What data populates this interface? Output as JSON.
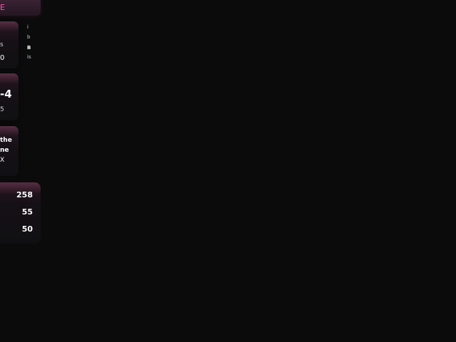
{
  "header": {
    "title": "E"
  },
  "cards": [
    {
      "label": "s",
      "value": "0"
    },
    {
      "value": "-4",
      "sub": "5"
    },
    {
      "lines": [
        "the",
        "ne",
        "X"
      ]
    }
  ],
  "mini_column": [
    "i",
    "b",
    "B",
    "is"
  ],
  "stats": [
    "258",
    "55",
    "50"
  ],
  "colors": {
    "accent": "#ff4fb0",
    "background": "#0b0b0c",
    "card": "#151015"
  }
}
